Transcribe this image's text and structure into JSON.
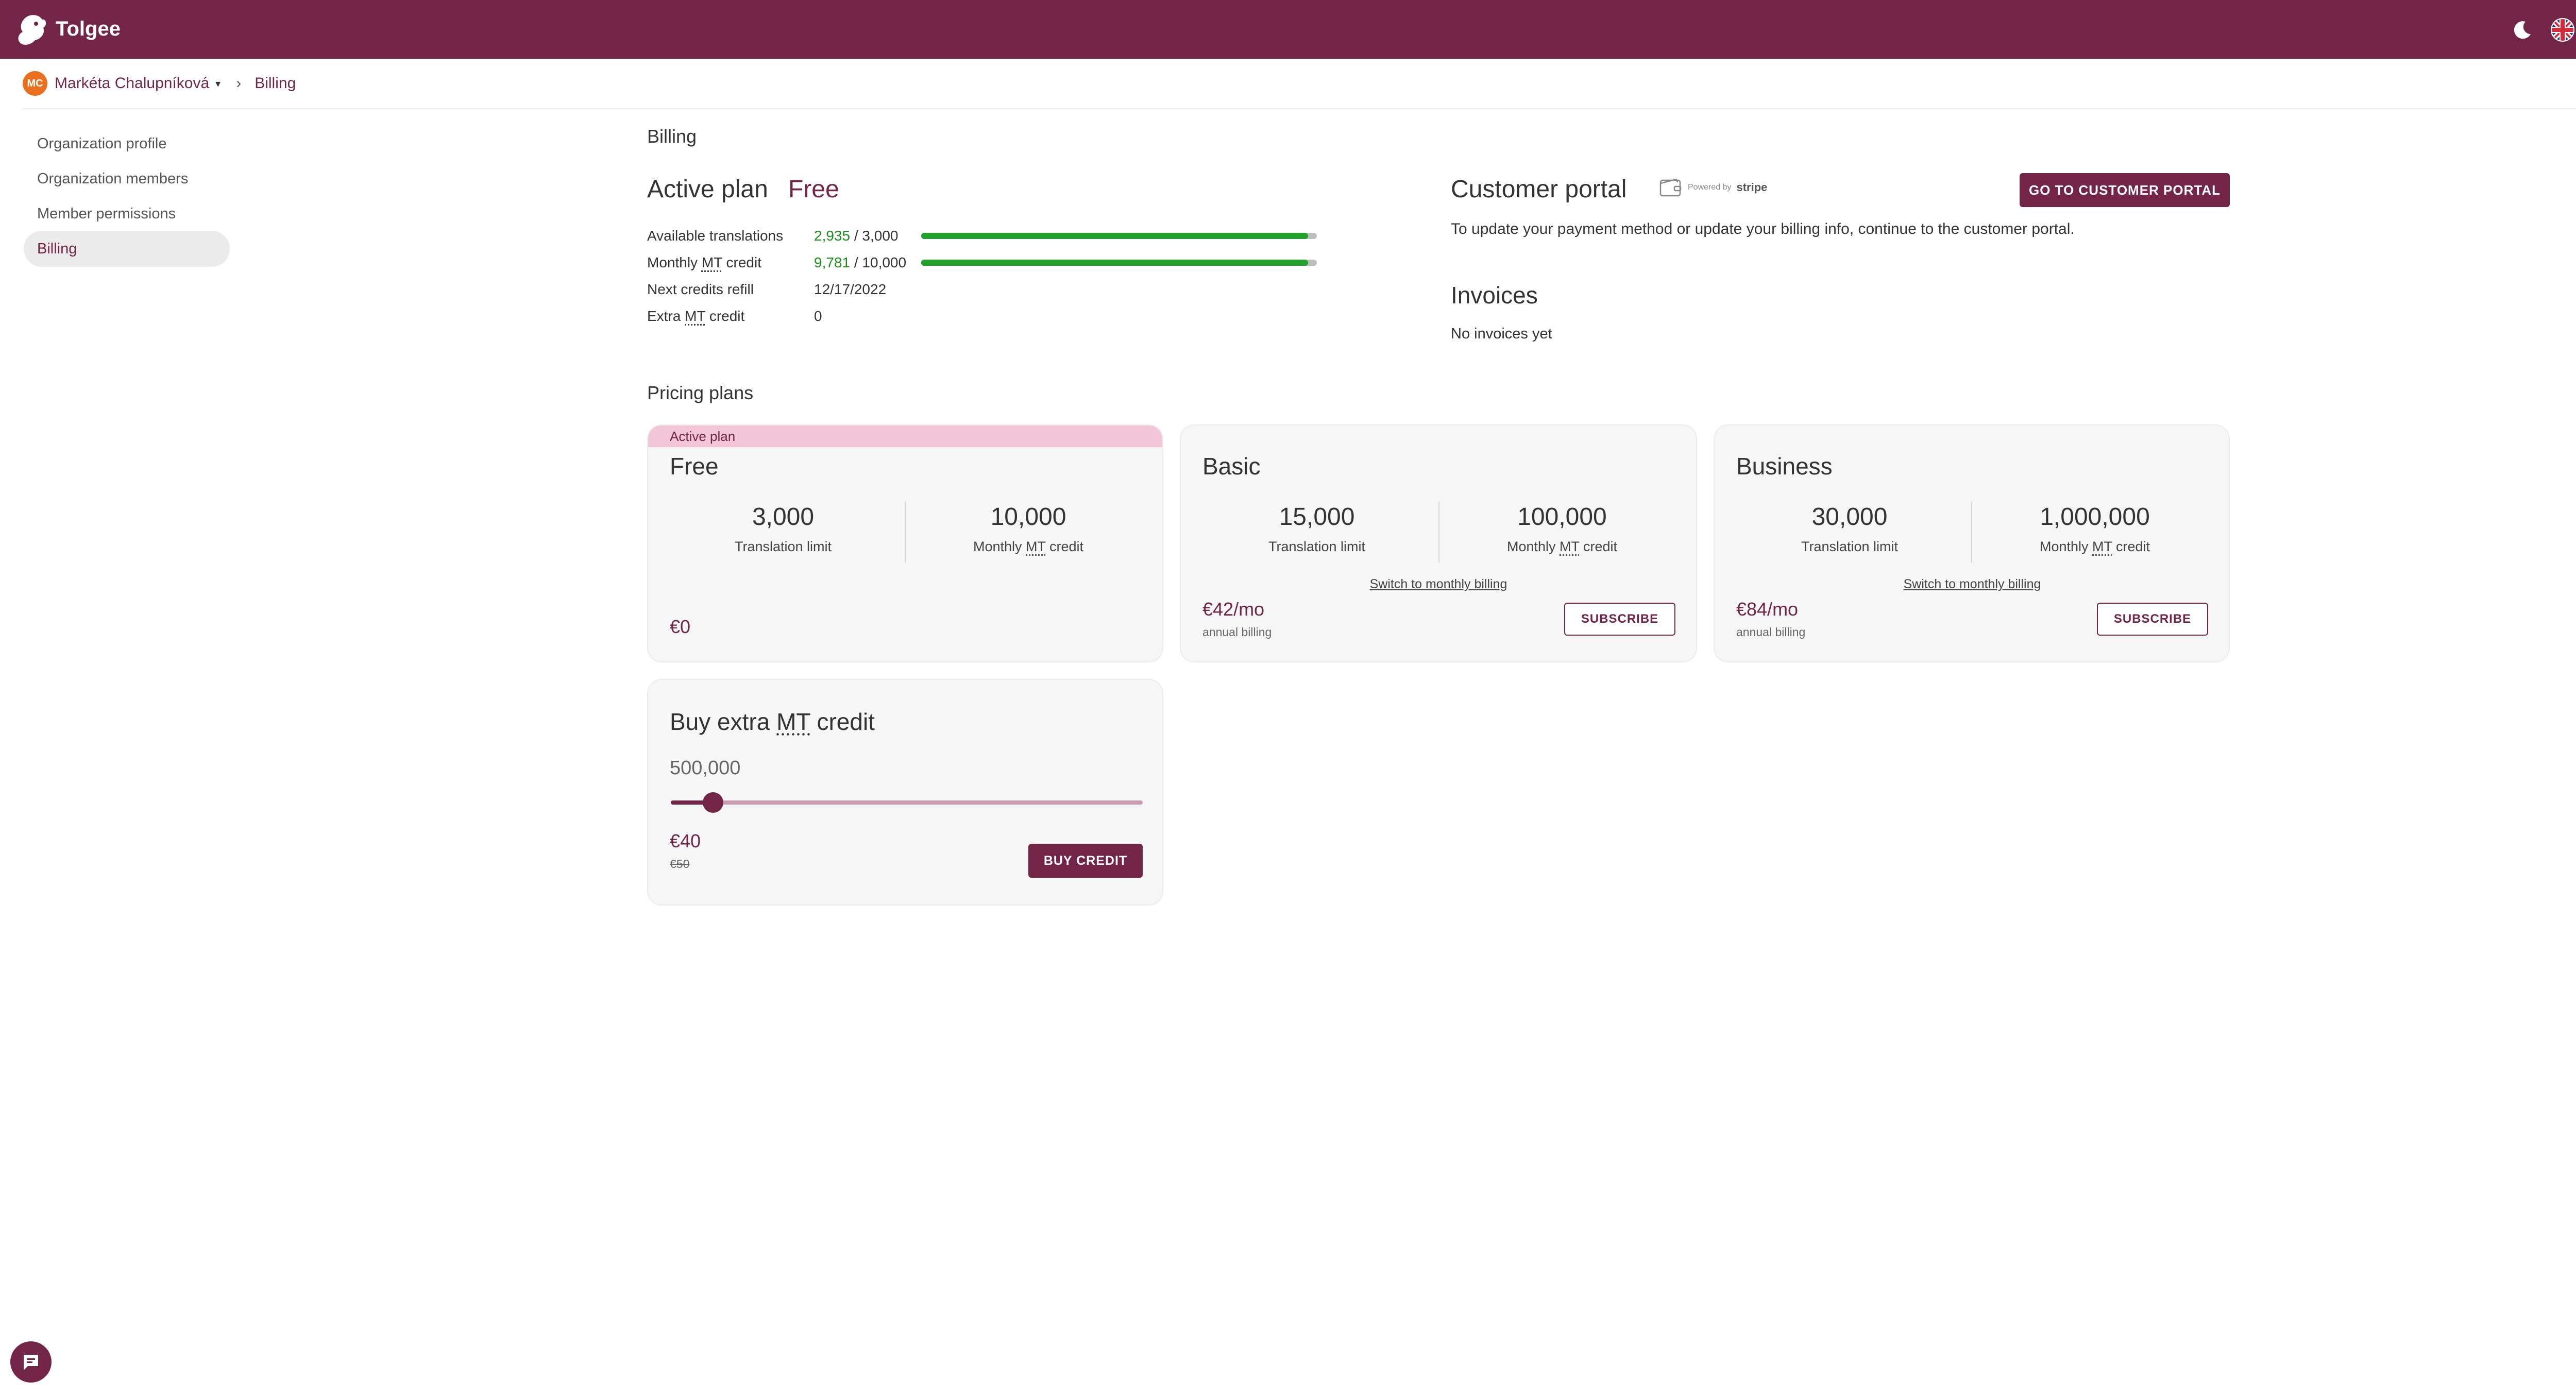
{
  "app": {
    "name": "Tolgee"
  },
  "header": {
    "icons": [
      "moon-icon",
      "uk-flag-icon",
      "user-avatar"
    ]
  },
  "breadcrumb": {
    "avatar_initials": "MC",
    "organization": "Markéta Chalupníková",
    "current": "Billing"
  },
  "sidebar": {
    "items": [
      {
        "label": "Organization profile"
      },
      {
        "label": "Organization members"
      },
      {
        "label": "Member permissions"
      },
      {
        "label": "Billing",
        "active": true
      }
    ]
  },
  "billing": {
    "title": "Billing",
    "active_plan_label": "Active plan",
    "active_plan_name": "Free",
    "stats": {
      "available_translations": {
        "label": "Available translations",
        "used": "2,935",
        "total": "/ 3,000",
        "progress": 0.978
      },
      "monthly_mt_credit": {
        "label_prefix": "Monthly ",
        "label_mt": "MT",
        "label_suffix": " credit",
        "used": "9,781",
        "total": "/ 10,000",
        "progress": 0.978
      },
      "next_refill": {
        "label": "Next credits refill",
        "value": "12/17/2022"
      },
      "extra_mt_credit": {
        "label_prefix": "Extra ",
        "label_mt": "MT",
        "label_suffix": " credit",
        "value": "0"
      }
    }
  },
  "customer_portal": {
    "title": "Customer portal",
    "powered_by": "Powered by",
    "stripe": "stripe",
    "button": "GO TO CUSTOMER PORTAL",
    "description": "To update your payment method or update your billing info, continue to the customer portal."
  },
  "invoices": {
    "title": "Invoices",
    "empty": "No invoices yet"
  },
  "pricing": {
    "title": "Pricing plans",
    "mt_label_prefix": "Monthly ",
    "mt_label_mt": "MT",
    "mt_label_suffix": " credit",
    "plans": [
      {
        "badge": "Active plan",
        "name": "Free",
        "translation_limit": "3,000",
        "translation_limit_label": "Translation limit",
        "mt_credit": "10,000",
        "price": "€0"
      },
      {
        "name": "Basic",
        "translation_limit": "15,000",
        "translation_limit_label": "Translation limit",
        "mt_credit": "100,000",
        "switch_label": "Switch to monthly billing",
        "price": "€42/mo",
        "price_note": "annual billing",
        "button": "SUBSCRIBE"
      },
      {
        "name": "Business",
        "translation_limit": "30,000",
        "translation_limit_label": "Translation limit",
        "mt_credit": "1,000,000",
        "switch_label": "Switch to monthly billing",
        "price": "€84/mo",
        "price_note": "annual billing",
        "button": "SUBSCRIBE"
      }
    ]
  },
  "extra_credit": {
    "title_prefix": "Buy extra ",
    "title_mt": "MT",
    "title_suffix": " credit",
    "amount": "500,000",
    "slider_position": 0.09,
    "price": "€40",
    "old_price": "€50",
    "button": "BUY CREDIT"
  },
  "colors": {
    "brand": "#732547",
    "progress": "#22a22a",
    "active_badge_bg": "#f2c6d8",
    "avatar_orange": "#e8701f"
  }
}
